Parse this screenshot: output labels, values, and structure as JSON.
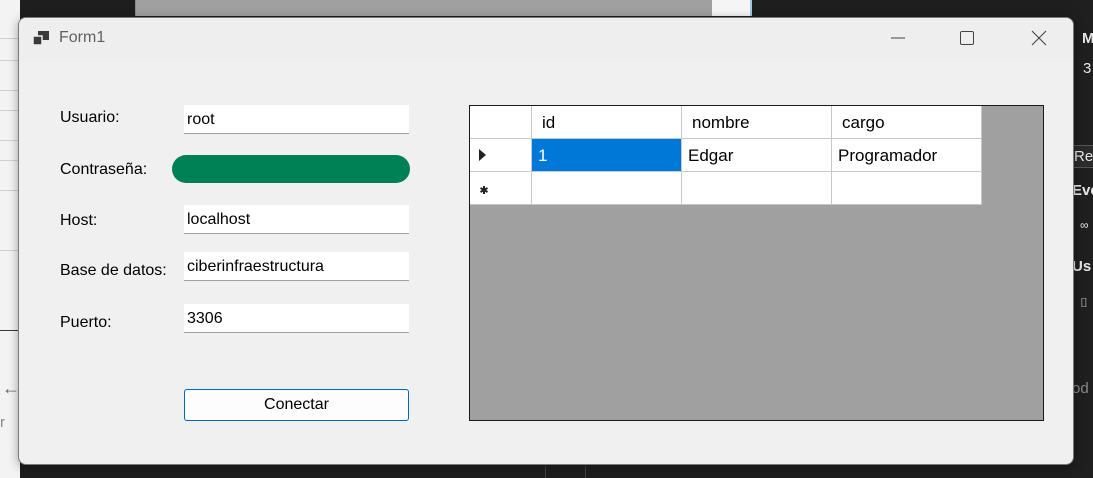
{
  "window": {
    "title": "Form1",
    "icon": "windows-form-icon",
    "controls": [
      "minimize-icon",
      "maximize-icon",
      "close-icon"
    ]
  },
  "form": {
    "usuario_label": "Usuario:",
    "usuario_value": "root",
    "contrasena_label": "Contraseña:",
    "contrasena_value": "",
    "host_label": "Host:",
    "host_value": "localhost",
    "base_label": "Base de datos:",
    "base_value": "ciberinfraestructura",
    "puerto_label": "Puerto:",
    "puerto_value": "3306",
    "connect_label": "Conectar",
    "password_fill_color": "#008055"
  },
  "grid": {
    "columns": [
      "id",
      "nombre",
      "cargo"
    ],
    "rows": [
      [
        "1",
        "Edgar",
        "Programador"
      ]
    ],
    "selection_color": "#0078d7"
  },
  "background": {
    "right_fragments": [
      "M",
      "3",
      "Re",
      "Eve",
      "∞",
      "Us",
      "⌷",
      "od"
    ],
    "left_fragments": [
      "←",
      "r"
    ]
  }
}
